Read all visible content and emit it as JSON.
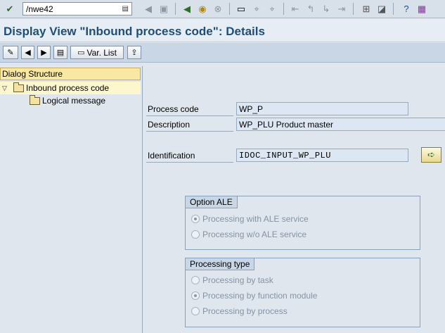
{
  "toolbar": {
    "command_field_value": "/nwe42",
    "enter_icon": "check-icon",
    "dropdown_icon": "dropdown-arrow-icon",
    "save_icon": "save-icon",
    "back_icon": "back-icon",
    "exit_icon": "exit-icon",
    "cancel_icon": "cancel-icon",
    "print_icon": "print-icon",
    "find_icon": "find-icon",
    "find_next_icon": "find-next-icon",
    "first_page_icon": "first-page-icon",
    "prev_page_icon": "previous-page-icon",
    "next_page_icon": "next-page-icon",
    "last_page_icon": "last-page-icon",
    "new_session_icon": "new-session-icon",
    "shortcut_icon": "shortcut-icon",
    "help_icon": "help-icon",
    "layout_icon": "customize-layout-icon"
  },
  "title": "Display View \"Inbound process code\": Details",
  "app_toolbar": {
    "change_icon": "display-change-icon",
    "prev_icon": "previous-entry-icon",
    "next_icon": "next-entry-icon",
    "other_entry_icon": "other-entry-icon",
    "var_list_label": "Var. List",
    "export_icon": "export-icon"
  },
  "dialog_structure": {
    "header": "Dialog Structure",
    "items": [
      {
        "label": "Inbound process code"
      },
      {
        "label": "Logical message"
      }
    ]
  },
  "form": {
    "process_code_label": "Process code",
    "process_code_value": "WP_P",
    "description_label": "Description",
    "description_value": "WP_PLU  Product master",
    "identification_label": "Identification",
    "identification_value": "IDOC_INPUT_WP_PLU",
    "display_function_icon": "navigate-arrow-icon"
  },
  "option_ale": {
    "title": "Option ALE",
    "options": [
      {
        "label": "Processing with ALE service",
        "selected": true
      },
      {
        "label": "Processing w/o ALE service",
        "selected": false
      }
    ]
  },
  "processing_type": {
    "title": "Processing type",
    "options": [
      {
        "label": "Processing by task",
        "selected": false
      },
      {
        "label": "Processing by function module",
        "selected": true
      },
      {
        "label": "Processing by process",
        "selected": false
      }
    ]
  },
  "colors": {
    "title": "#1f4e79",
    "tree_header": "#f9e8a3",
    "selected_node": "#fdf7cc",
    "field_bg": "#dde7f3"
  }
}
